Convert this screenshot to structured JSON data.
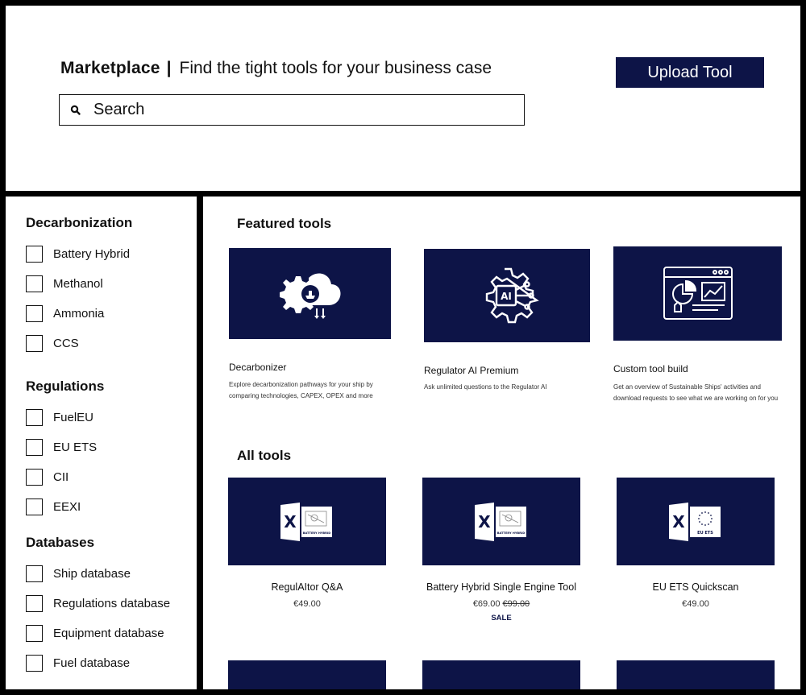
{
  "header": {
    "title": "Marketplace",
    "separator": "|",
    "subtitle": "Find the tight tools for your business case",
    "search_placeholder": "Search",
    "search_icon": "search-icon",
    "upload_label": "Upload Tool",
    "accent_color": "#0d1447"
  },
  "sidebar": {
    "groups": [
      {
        "heading": "Decarbonization",
        "items": [
          "Battery Hybrid",
          "Methanol",
          "Ammonia",
          "CCS"
        ]
      },
      {
        "heading": "Regulations",
        "items": [
          "FuelEU",
          "EU ETS",
          "CII",
          "EEXI"
        ]
      },
      {
        "heading": "Databases",
        "items": [
          "Ship database",
          "Regulations database",
          "Equipment database",
          "Fuel database"
        ]
      }
    ]
  },
  "main": {
    "featured_title": "Featured tools",
    "featured": [
      {
        "title": "Decarbonizer",
        "description": "Explore decarbonization pathways for your ship by comparing technologies, CAPEX, OPEX and more",
        "icon": "cloud-gear-ship-icon"
      },
      {
        "title": "Regulator AI Premium",
        "description": "Ask unlimited questions to the Regulator AI",
        "icon": "ai-chip-gear-icon"
      },
      {
        "title": "Custom tool build",
        "description": "Get an overview of Sustainable Ships' activities and download requests to see what we are working on for you",
        "icon": "dashboard-window-icon"
      }
    ],
    "all_title": "All tools",
    "tools": [
      {
        "title": "RegulAItor Q&A",
        "price": "€49.00",
        "old_price": "",
        "badge": "",
        "thumb_caption": "BATTERY HYBRID"
      },
      {
        "title": "Battery Hybrid Single Engine Tool",
        "price": "€69.00",
        "old_price": "€99.00",
        "badge": "SALE",
        "thumb_caption": "BATTERY HYBRID"
      },
      {
        "title": "EU ETS Quickscan",
        "price": "€49.00",
        "old_price": "",
        "badge": "",
        "thumb_caption": "EU ETS"
      }
    ],
    "excel_letter": "X",
    "ai_chip_label": "AI"
  }
}
